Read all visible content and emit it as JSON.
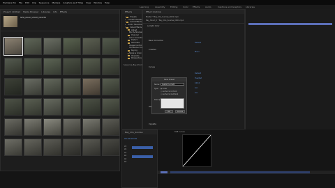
{
  "menubar": {
    "app": "Premiere Pro",
    "items": [
      "File",
      "Edit",
      "Clip",
      "Sequence",
      "Markers",
      "Graphics and Titles",
      "View",
      "Window",
      "Help"
    ]
  },
  "workspaces": {
    "items": [
      "Learning",
      "Assembly",
      "Editing",
      "Color",
      "Effects",
      "Audio",
      "Captions and Graphics",
      "Libraries"
    ]
  },
  "project_panel": {
    "tabs": [
      "Project: Untitled",
      "Media Browser",
      "Libraries",
      "Info",
      "Effects"
    ],
    "preview_name": "NEW_ROAD_SHORT_MASTER",
    "clip_name_prefix": "WIDE_INSIDE_B012_C0"
  },
  "folder_panel": {
    "tab": "Effects",
    "items": [
      "Presets",
      "Lumetri Presets",
      "Audio Effects",
      "Audio Transitions",
      "Video Effects",
      "Adjust",
      "Blur & Sharpen",
      "Channel",
      "Color Correction",
      "Distort",
      "Generate",
      "Image Control",
      "Immersive Video",
      "Keying",
      "Noise & Grain",
      "Obsolete",
      "Perspective"
    ],
    "sequence_name": "Sequence_Bay_Shoot_0"
  },
  "effect_controls": {
    "tab": "Effect Controls",
    "source": "Master * Bay_Chs_Sunrise_0001.mp4",
    "clip": "Bay_Shoot_0 * Bay_Chs_Sunrise_0001.mp4",
    "sections": [
      "Lumetri Color",
      "Basic Correction",
      "Creative",
      "Curves",
      "HSL Secondary",
      "Vignette"
    ],
    "values": [
      "Default",
      "Mono",
      "Default",
      "Hue/Sat",
      "100.0",
      "0.0",
      "0.0"
    ]
  },
  "dialog": {
    "title": "Save Preset",
    "name_label": "Name:",
    "name_value": "Custom Lumetri",
    "type_label": "Type:",
    "options": [
      "Scale",
      "Anchor to In Point",
      "Anchor to Out Point"
    ],
    "desc_label": "Description:",
    "ok": "OK",
    "cancel": "Cancel"
  },
  "timeline": {
    "tab": "Bay_Chs_Sunrise",
    "timecode": "00:00:00:00",
    "tracks": [
      "V3",
      "V2",
      "V1",
      "A1",
      "A2",
      "A3"
    ]
  },
  "curves": {
    "label": "RGB Curves"
  },
  "colors": {
    "accent": "#5b8ed8",
    "folder": "#c9a14a",
    "clip_blue": "#5b6fb8"
  }
}
